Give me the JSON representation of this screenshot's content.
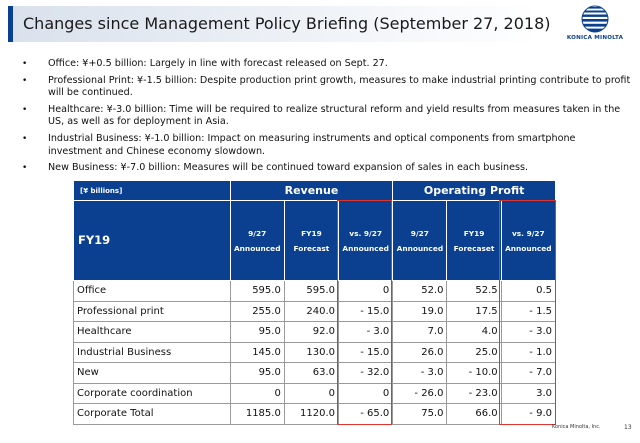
{
  "title": "Changes since Management Policy Briefing (September 27, 2018)",
  "logo": {
    "wordmark": "KONICA MINOLTA",
    "icon": "globe-logo-icon",
    "color": "#0b3f8f"
  },
  "bullets": [
    "Office: ¥+0.5 billion: Largely in line with forecast released on Sept. 27.",
    "Professional Print: ¥-1.5 billion: Despite production print growth, measures to make industrial printing contribute to profit will be continued.",
    "Healthcare: ¥-3.0 billion: Time will be required to realize structural reform and yield  results from measures taken in the US, as well as for deployment in Asia.",
    "Industrial Business: ¥-1.0 billion: Impact on measuring instruments and optical components from smartphone investment and Chinese economy slowdown.",
    "New Business: ¥-7.0 billion: Measures will be continued toward expansion of sales in each business."
  ],
  "table": {
    "unit": "[¥ billions]",
    "fy_label": "FY19",
    "group_revenue": "Revenue",
    "group_op": "Operating Profit",
    "columns": [
      {
        "line1": "9/27",
        "line2": "Announced"
      },
      {
        "line1": "FY19",
        "line2": "Forecast"
      },
      {
        "line1": "vs. 9/27",
        "line2": "Announced"
      },
      {
        "line1": "9/27",
        "line2": "Announced"
      },
      {
        "line1": "FY19",
        "line2": "Forecaset"
      },
      {
        "line1": "vs. 9/27",
        "line2": "Announced"
      }
    ],
    "rows": [
      {
        "label": "Office",
        "values": [
          "595.0",
          "595.0",
          "0",
          "52.0",
          "52.5",
          "0.5"
        ]
      },
      {
        "label": "Professional print",
        "values": [
          "255.0",
          "240.0",
          "- 15.0",
          "19.0",
          "17.5",
          "- 1.5"
        ]
      },
      {
        "label": "Healthcare",
        "values": [
          "95.0",
          "92.0",
          "- 3.0",
          "7.0",
          "4.0",
          "- 3.0"
        ]
      },
      {
        "label": "Industrial Business",
        "values": [
          "145.0",
          "130.0",
          "- 15.0",
          "26.0",
          "25.0",
          "- 1.0"
        ]
      },
      {
        "label": "New",
        "values": [
          "95.0",
          "63.0",
          "- 32.0",
          "- 3.0",
          "- 10.0",
          "- 7.0"
        ]
      },
      {
        "label": "Corporate coordination",
        "values": [
          "0",
          "0",
          "0",
          "- 26.0",
          "- 23.0",
          "3.0"
        ]
      },
      {
        "label": "Corporate Total",
        "values": [
          "1185.0",
          "1120.0",
          "- 65.0",
          "75.0",
          "66.0",
          "- 9.0"
        ]
      }
    ],
    "header_color": "#0b3f8f",
    "highlight_color": "#e0342d"
  },
  "footer": {
    "brand": "Konica Minolta, Inc.",
    "page": "13"
  }
}
